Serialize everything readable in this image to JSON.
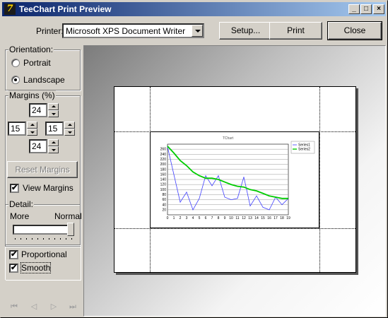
{
  "window": {
    "title": "TeeChart Print Preview",
    "icon_glyph": "7",
    "minimize_glyph": "_",
    "maximize_glyph": "□",
    "close_glyph": "×"
  },
  "toolbar": {
    "printer_label": "Printer:",
    "printer_value": "Microsoft XPS Document Writer",
    "setup_label": "Setup...",
    "print_label": "Print",
    "close_label": "Close"
  },
  "orientation": {
    "title": "Orientation:",
    "portrait_label": "Portrait",
    "landscape_label": "Landscape",
    "selected": "Landscape"
  },
  "margins": {
    "title": "Margins (%)",
    "top": "24",
    "left": "15",
    "right": "15",
    "bottom": "24",
    "reset_label": "Reset Margins",
    "view_margins_label": "View Margins",
    "view_margins_checked": true
  },
  "detail": {
    "title": "Detail:",
    "more_label": "More",
    "normal_label": "Normal",
    "level": 1.0
  },
  "options": {
    "proportional_label": "Proportional",
    "proportional_checked": true,
    "smooth_label": "Smooth",
    "smooth_checked": true,
    "check_glyph": "✔"
  },
  "nav_glyphs": {
    "first": "⏮",
    "prev": "◁",
    "next": "▷",
    "last": "⏭"
  },
  "chart_data": {
    "type": "line",
    "title": "TChart",
    "x": [
      0,
      1,
      2,
      3,
      4,
      5,
      6,
      7,
      8,
      9,
      10,
      11,
      12,
      13,
      14,
      15,
      16,
      17,
      18,
      19
    ],
    "ylim": [
      0,
      280
    ],
    "yticks": [
      20,
      40,
      60,
      80,
      100,
      120,
      140,
      160,
      180,
      200,
      220,
      240,
      260
    ],
    "legend_position": "top-right",
    "series": [
      {
        "name": "Series1",
        "color": "#4040ff",
        "values": [
          270,
          160,
          50,
          90,
          20,
          65,
          155,
          115,
          155,
          70,
          60,
          65,
          150,
          35,
          75,
          30,
          20,
          70,
          40,
          65
        ]
      },
      {
        "name": "Series2",
        "color": "#00cc00",
        "values": [
          272,
          245,
          215,
          195,
          170,
          155,
          145,
          145,
          140,
          130,
          120,
          113,
          110,
          100,
          95,
          85,
          75,
          70,
          65,
          65
        ]
      }
    ]
  }
}
